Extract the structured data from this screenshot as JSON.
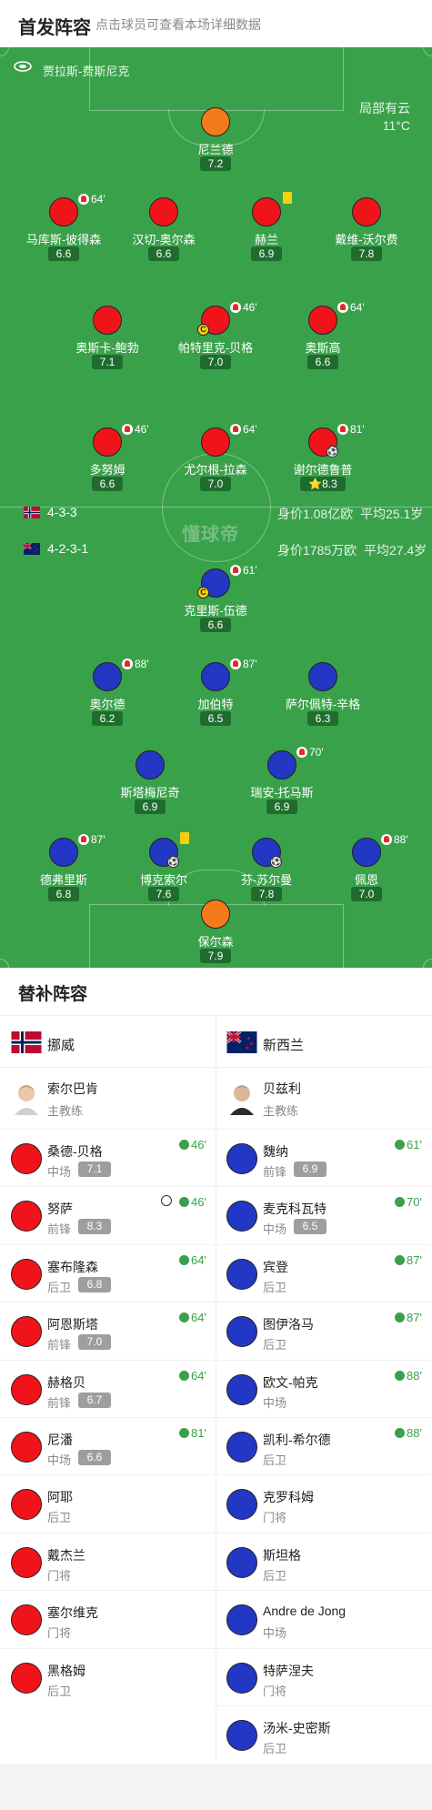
{
  "header": {
    "title": "首发阵容",
    "subtitle": "点击球员可查看本场详细数据"
  },
  "pitch": {
    "venue": "贾拉斯-费斯尼克",
    "weather": "局部有云",
    "temperature": "11°C",
    "watermark": "懂球帝",
    "home": {
      "formation": "4-3-3",
      "market_value": "身价1.08亿欧",
      "avg_age": "平均25.1岁"
    },
    "away": {
      "formation": "4-2-3-1",
      "market_value": "身价1785万欧",
      "avg_age": "平均27.4岁"
    },
    "players": [
      {
        "name": "尼兰德",
        "rating": "7.2",
        "color": "orange"
      },
      {
        "name": "马库斯-彼得森",
        "rating": "6.6",
        "color": "red",
        "sub": "64'"
      },
      {
        "name": "汉切-奥尔森",
        "rating": "6.6",
        "color": "red"
      },
      {
        "name": "赫兰",
        "rating": "6.9",
        "color": "red",
        "yellow": true
      },
      {
        "name": "戴维-沃尔费",
        "rating": "7.8",
        "color": "red"
      },
      {
        "name": "奥斯卡-鲍勃",
        "rating": "7.1",
        "color": "red"
      },
      {
        "name": "帕特里克-贝格",
        "rating": "7.0",
        "color": "red",
        "sub": "46'",
        "captain": "C"
      },
      {
        "name": "奥斯高",
        "rating": "6.6",
        "color": "red",
        "sub": "64'"
      },
      {
        "name": "多努姆",
        "rating": "6.6",
        "color": "red",
        "sub": "46'"
      },
      {
        "name": "尤尔根-拉森",
        "rating": "7.0",
        "color": "red",
        "sub": "64'"
      },
      {
        "name": "谢尔德鲁普",
        "rating": "8.3",
        "color": "red",
        "sub": "81'",
        "star": true,
        "goal": true
      },
      {
        "name": "克里斯-伍德",
        "rating": "6.6",
        "color": "blue",
        "sub": "61'",
        "captain": "C"
      },
      {
        "name": "奥尔德",
        "rating": "6.2",
        "color": "blue",
        "sub": "88'"
      },
      {
        "name": "加伯特",
        "rating": "6.5",
        "color": "blue",
        "sub": "87'"
      },
      {
        "name": "萨尔佩特-辛格",
        "rating": "6.3",
        "color": "blue"
      },
      {
        "name": "斯塔梅尼奇",
        "rating": "6.9",
        "color": "blue"
      },
      {
        "name": "瑞安-托马斯",
        "rating": "6.9",
        "color": "blue",
        "sub": "70'"
      },
      {
        "name": "德弗里斯",
        "rating": "6.8",
        "color": "blue",
        "sub": "87'"
      },
      {
        "name": "博克索尔",
        "rating": "7.6",
        "color": "blue",
        "yellow": true,
        "goal": true
      },
      {
        "name": "芬-苏尔曼",
        "rating": "7.8",
        "color": "blue",
        "goal": true
      },
      {
        "name": "佩恩",
        "rating": "7.0",
        "color": "blue",
        "sub": "88'"
      },
      {
        "name": "保尔森",
        "rating": "7.9",
        "color": "orange"
      }
    ]
  },
  "subs": {
    "title": "替补阵容",
    "home": {
      "team": "挪威",
      "coach": {
        "name": "索尔巴肯",
        "role": "主教练"
      },
      "players": [
        {
          "name": "桑德-贝格",
          "pos": "中场",
          "rating": "7.1",
          "in": "46'"
        },
        {
          "name": "努萨",
          "pos": "前锋",
          "rating": "8.3",
          "in": "46'",
          "goal": true
        },
        {
          "name": "塞布隆森",
          "pos": "后卫",
          "rating": "6.8",
          "in": "64'"
        },
        {
          "name": "阿恩斯塔",
          "pos": "前锋",
          "rating": "7.0",
          "in": "64'"
        },
        {
          "name": "赫格贝",
          "pos": "前锋",
          "rating": "6.7",
          "in": "64'"
        },
        {
          "name": "尼潘",
          "pos": "中场",
          "rating": "6.6",
          "in": "81'"
        },
        {
          "name": "阿耶",
          "pos": "后卫"
        },
        {
          "name": "戴杰兰",
          "pos": "门将"
        },
        {
          "name": "塞尔维克",
          "pos": "门将"
        },
        {
          "name": "黑格姆",
          "pos": "后卫"
        }
      ]
    },
    "away": {
      "team": "新西兰",
      "coach": {
        "name": "贝兹利",
        "role": "主教练"
      },
      "players": [
        {
          "name": "魏纳",
          "pos": "前锋",
          "rating": "6.9",
          "in": "61'"
        },
        {
          "name": "麦克科瓦特",
          "pos": "中场",
          "rating": "6.5",
          "in": "70'"
        },
        {
          "name": "宾登",
          "pos": "后卫",
          "in": "87'"
        },
        {
          "name": "图伊洛马",
          "pos": "后卫",
          "in": "87'"
        },
        {
          "name": "欧文-帕克",
          "pos": "中场",
          "in": "88'"
        },
        {
          "name": "凯利-希尔德",
          "pos": "后卫",
          "in": "88'"
        },
        {
          "name": "克罗科姆",
          "pos": "门将"
        },
        {
          "name": "斯坦格",
          "pos": "后卫"
        },
        {
          "name": "Andre de Jong",
          "pos": "中场"
        },
        {
          "name": "特萨涅夫",
          "pos": "门将"
        },
        {
          "name": "汤米-史密斯",
          "pos": "后卫"
        }
      ]
    }
  },
  "colors": {
    "pitch": "#3aa14b",
    "home": "#f0141a",
    "away": "#2337c5",
    "keeper": "#f47a1c",
    "accent": "#3aa14b"
  }
}
